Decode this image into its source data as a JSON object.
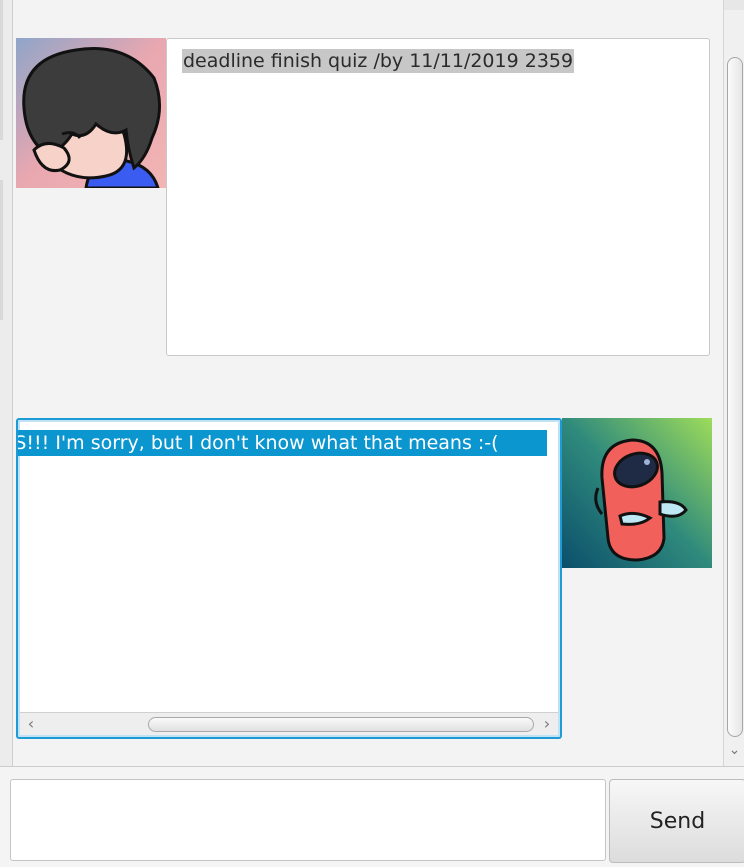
{
  "dialog": {
    "user_message": "deadline finish quiz /by 11/11/2019 2359",
    "duke_message": "OOPS!!! I'm sorry, but I don't know what that means :-("
  },
  "input": {
    "placeholder": "",
    "value": ""
  },
  "send_button": {
    "label": "Send"
  },
  "scroll_icons": {
    "left": "‹",
    "right": "›",
    "down": "⌄"
  },
  "colors": {
    "selection_blue": "#0b96d0",
    "focus_border": "#1e9ad6",
    "user_highlight": "#c7c7c7"
  }
}
